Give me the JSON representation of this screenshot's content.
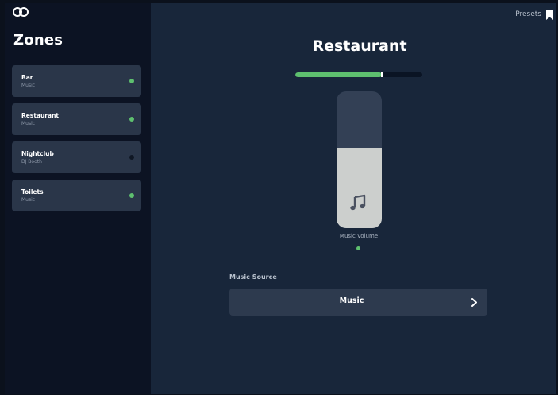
{
  "app": {
    "logo_icon": "infinity-logo-icon"
  },
  "sidebar": {
    "title": "Zones",
    "zones": [
      {
        "name": "Bar",
        "source": "Music",
        "status_color": "#5ec06f"
      },
      {
        "name": "Restaurant",
        "source": "Music",
        "status_color": "#5ec06f"
      },
      {
        "name": "Nightclub",
        "source": "DJ Booth",
        "status_color": "#0f1724"
      },
      {
        "name": "Toilets",
        "source": "Music",
        "status_color": "#5ec06f"
      }
    ]
  },
  "header": {
    "presets_label": "Presets",
    "presets_icon": "bookmark-icon"
  },
  "main": {
    "title": "Restaurant",
    "level_meter": {
      "value": 0.68,
      "color": "#5ec06f"
    },
    "volume": {
      "label": "Music Volume",
      "value": 0.59,
      "icon": "music-note-icon"
    },
    "music_source": {
      "label": "Music Source",
      "value": "Music",
      "icon": "chevron-right-icon"
    }
  },
  "colors": {
    "accent_green": "#5ec06f",
    "panel": "#18263a",
    "sidebar": "#0c1323"
  }
}
